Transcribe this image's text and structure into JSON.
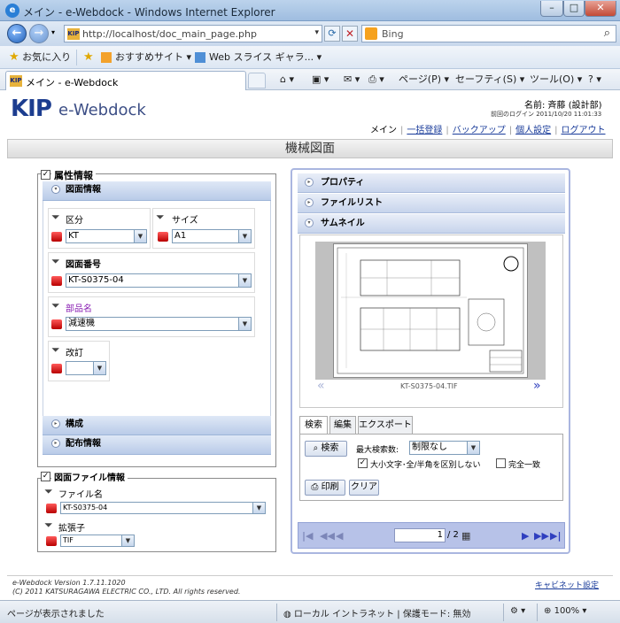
{
  "browser": {
    "window_title": "メイン - e-Webdock - Windows Internet Explorer",
    "url": "http://localhost/doc_main_page.php",
    "search_placeholder": "Bing",
    "favorites_label": "お気に入り",
    "fav_items": [
      "おすすめサイト ▾",
      "Web スライス ギャラ... ▾"
    ],
    "tab_title": "メイン - e-Webdock",
    "commands": {
      "page": "ページ(P) ▾",
      "safety": "セーフティ(S) ▾",
      "tools": "ツール(O) ▾"
    },
    "status_text": "ページが表示されました",
    "zone": "ローカル イントラネット | 保護モード: 無効",
    "zoom": "100%"
  },
  "app": {
    "logo_main": "KIP",
    "logo_sub": "e-Webdock",
    "user_label": "名前: 斉藤 (設計部)",
    "last_login": "前回のログイン 2011/10/20 11:01:33",
    "menu": [
      {
        "label": "メイン",
        "current": true
      },
      {
        "label": "一括登録",
        "current": false
      },
      {
        "label": "バックアップ",
        "current": false
      },
      {
        "label": "個人設定",
        "current": false
      },
      {
        "label": "ログアウト",
        "current": false
      }
    ],
    "page_title": "機械図面"
  },
  "attributes": {
    "title": "属性情報",
    "section_drawing": "図面情報",
    "kubun": {
      "label": "区分",
      "value": "KT"
    },
    "size": {
      "label": "サイズ",
      "value": "A1"
    },
    "drawing_no": {
      "label": "図面番号",
      "value": "KT-S0375-04"
    },
    "part_name": {
      "label": "部品名",
      "value": "減速機"
    },
    "revision": {
      "label": "改訂",
      "value": ""
    },
    "section_config": "構成",
    "section_dist": "配布情報"
  },
  "file_info": {
    "title": "図面ファイル情報",
    "filename": {
      "label": "ファイル名",
      "value": "KT-S0375-04"
    },
    "extension": {
      "label": "拡張子",
      "value": "TIF"
    }
  },
  "right": {
    "sections": [
      "プロパティ",
      "ファイルリスト",
      "サムネイル"
    ],
    "thumb_caption": "KT-S0375-04.TIF",
    "tabs": [
      "検索",
      "編集",
      "エクスポート"
    ],
    "search_button": "検索",
    "max_label": "最大検索数:",
    "max_value": "制限なし",
    "case_label": "大小文字･全/半角を区別しない",
    "exact_label": "完全一致",
    "print_button": "印刷",
    "clear_button": "クリア",
    "page_current": "1",
    "page_total": "/ 2"
  },
  "footer": {
    "version": "e-Webdock Version 1.7.11.1020",
    "copyright": "(C) 2011 KATSURAGAWA ELECTRIC CO., LTD. All rights reserved.",
    "cabinet_link": "キャビネット設定"
  }
}
